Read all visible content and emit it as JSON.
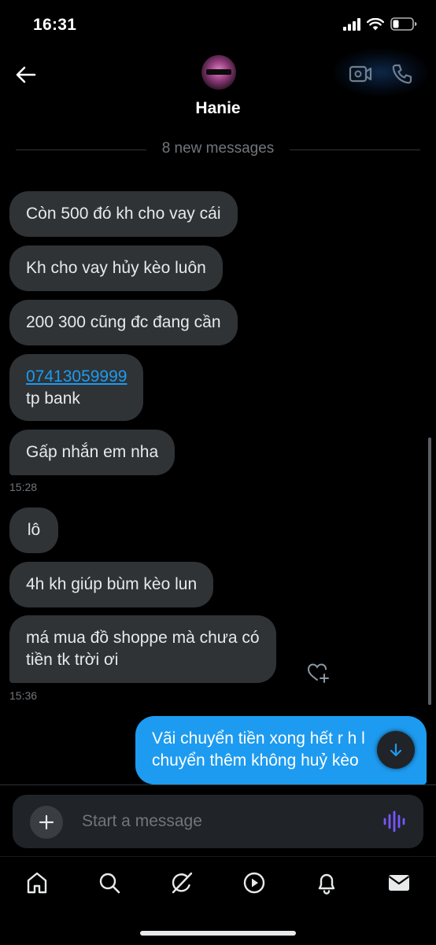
{
  "status_bar": {
    "time": "16:31"
  },
  "header": {
    "contact_name": "Hanie"
  },
  "divider": {
    "text": "8 new messages"
  },
  "messages": {
    "m1": "Còn 500 đó kh cho vay cái",
    "m2": "Kh cho vay hủy kèo luôn",
    "m3": "200 300 cũng đc đang cần",
    "m4_link": "07413059999",
    "m4_text": "tp bank",
    "m5": "Gấp nhắn em nha",
    "stamp1": "15:28",
    "m6": "lô",
    "m7": "4h kh giúp bùm kèo lun",
    "m8_line1": "má mua đồ shoppe mà chưa có",
    "m8_line2": "tiền tk trời ơi",
    "stamp2": "15:36",
    "sent_line1": "Vãi chuyển tiền xong hết r h l",
    "sent_line2": "chuyển thêm không huỷ kèo"
  },
  "composer": {
    "placeholder": "Start a message"
  },
  "colors": {
    "accent": "#1d9bf0",
    "received_bubble": "#2f3336",
    "background": "#000000",
    "voice_icon": "#7856ff"
  },
  "icons": [
    "back-arrow-icon",
    "video-call-icon",
    "phone-icon",
    "heart-plus-icon",
    "arrow-down-icon",
    "plus-icon",
    "voice-wave-icon",
    "home-icon",
    "search-icon",
    "grok-icon",
    "play-icon",
    "bell-icon",
    "mail-icon"
  ]
}
